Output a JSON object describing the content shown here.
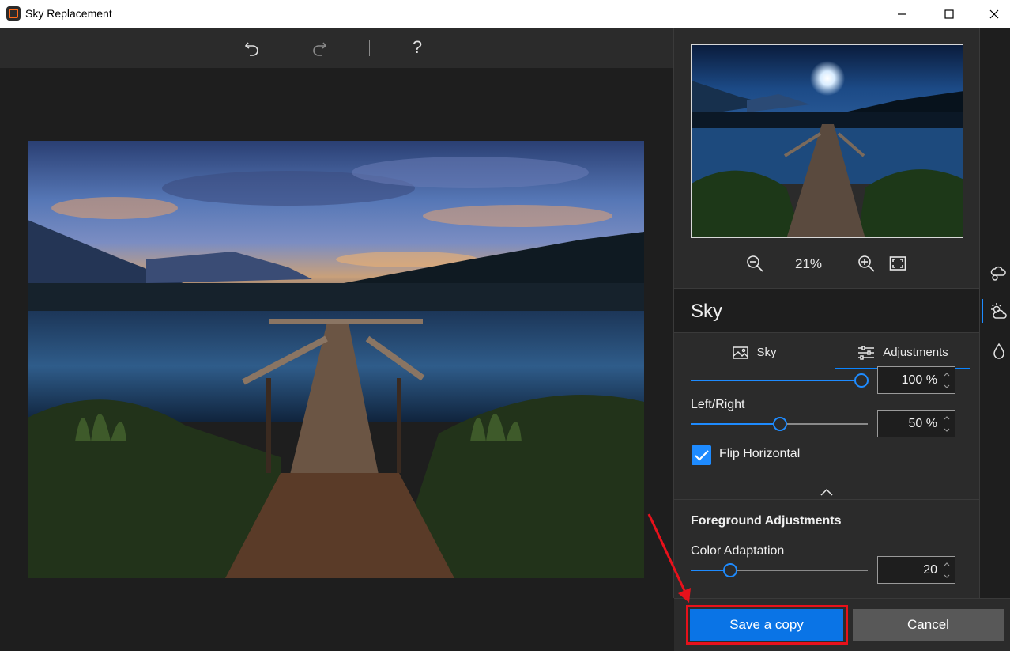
{
  "window": {
    "title": "Sky Replacement"
  },
  "toolbar": {
    "help_label": "?"
  },
  "preview": {
    "zoom_level": "21%"
  },
  "panel": {
    "title": "Sky",
    "tabs": [
      {
        "label": "Sky",
        "icon": "image-icon",
        "active": false
      },
      {
        "label": "Adjustments",
        "icon": "sliders-icon",
        "active": true
      }
    ]
  },
  "adjustments": {
    "top_slider": {
      "value_label": "100 %",
      "value": 100
    },
    "left_right": {
      "label": "Left/Right",
      "value_label": "50 %",
      "value": 50
    },
    "flip_horizontal": {
      "label": "Flip Horizontal",
      "checked": true
    }
  },
  "foreground": {
    "title": "Foreground Adjustments",
    "color_adaptation": {
      "label": "Color Adaptation",
      "value_label": "20",
      "value": 20
    }
  },
  "buttons": {
    "save": "Save a copy",
    "cancel": "Cancel"
  },
  "colors": {
    "accent": "#1e8bff",
    "save_button": "#0a74e6",
    "highlight": "#e8111b"
  }
}
